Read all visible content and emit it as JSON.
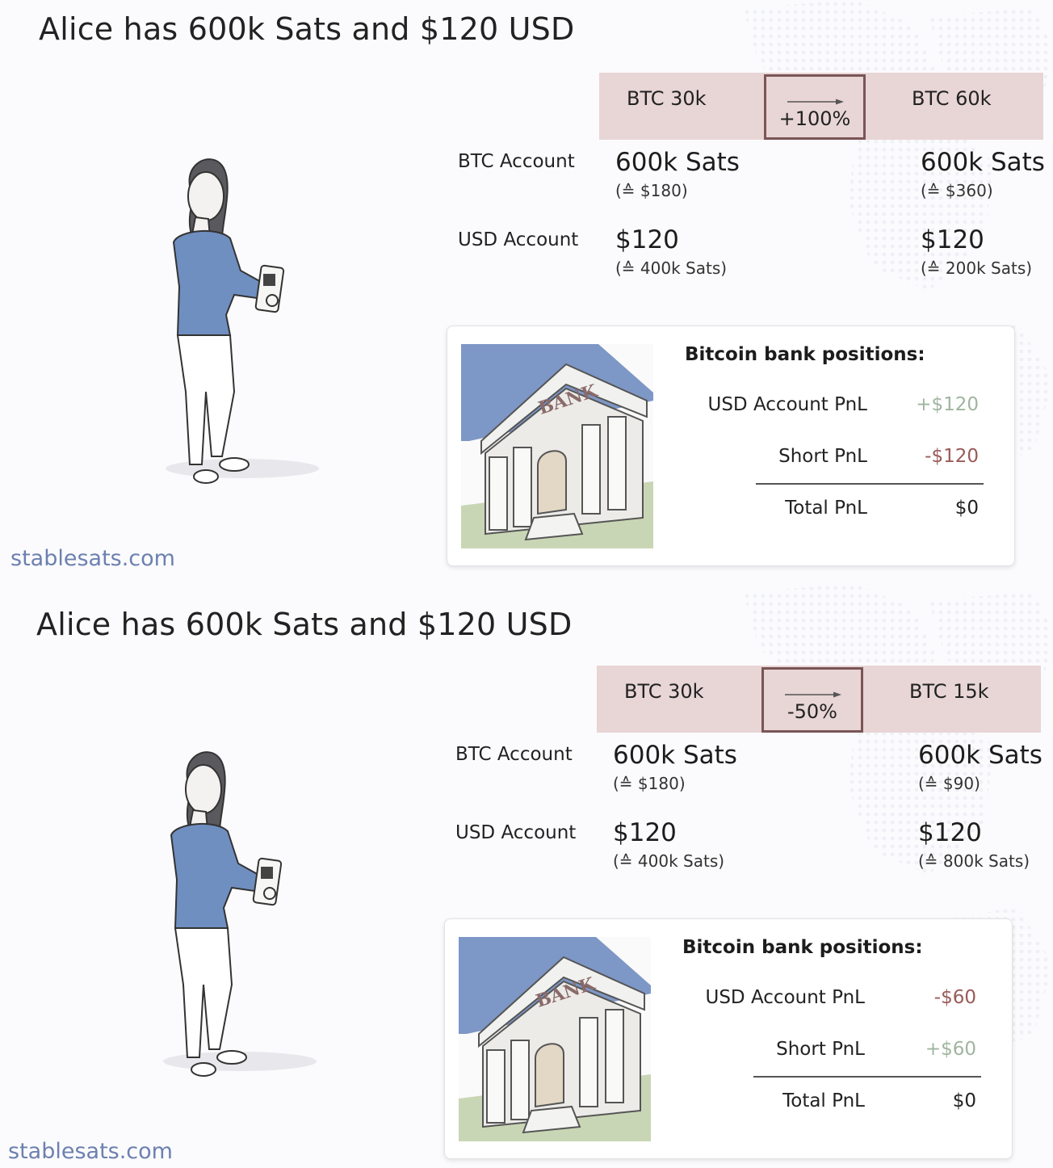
{
  "panels": [
    {
      "title": "Alice has 600k Sats and $120 USD",
      "price_from": "BTC 30k",
      "price_change": "+100%",
      "price_to": "BTC 60k",
      "btc_account": {
        "label": "BTC Account",
        "before": "600k Sats",
        "before_equiv": "(≙ $180)",
        "after": "600k Sats",
        "after_equiv": "(≙ $360)"
      },
      "usd_account": {
        "label": "USD Account",
        "before": "$120",
        "before_equiv": "(≙ 400k Sats)",
        "after": "$120",
        "after_equiv": "(≙ 200k Sats)"
      },
      "bank": {
        "bank_sign": "BANK",
        "title": "Bitcoin bank positions:",
        "usd_pnl_label": "USD Account PnL",
        "usd_pnl_value": "+$120",
        "usd_pnl_color": "#9fb59f",
        "short_pnl_label": "Short PnL",
        "short_pnl_value": "-$120",
        "short_pnl_color": "#9a5a58",
        "total_pnl_label": "Total PnL",
        "total_pnl_value": "$0"
      },
      "brand": "stablesats.com"
    },
    {
      "title": "Alice has 600k Sats and $120 USD",
      "price_from": "BTC 30k",
      "price_change": "-50%",
      "price_to": "BTC 15k",
      "btc_account": {
        "label": "BTC Account",
        "before": "600k Sats",
        "before_equiv": "(≙ $180)",
        "after": "600k Sats",
        "after_equiv": "(≙ $90)"
      },
      "usd_account": {
        "label": "USD Account",
        "before": "$120",
        "before_equiv": "(≙ 400k Sats)",
        "after": "$120",
        "after_equiv": "(≙ 800k Sats)"
      },
      "bank": {
        "bank_sign": "BANK",
        "title": "Bitcoin bank positions:",
        "usd_pnl_label": "USD Account PnL",
        "usd_pnl_value": "-$60",
        "usd_pnl_color": "#9a5a58",
        "short_pnl_label": "Short PnL",
        "short_pnl_value": "+$60",
        "short_pnl_color": "#9fb59f",
        "total_pnl_label": "Total PnL",
        "total_pnl_value": "$0"
      },
      "brand": "stablesats.com"
    }
  ],
  "colors": {
    "price_bar_bg": "#e8d5d5",
    "change_box_border": "#7a5456",
    "brand_text": "#6c80b0",
    "positive_pnl": "#9fb59f",
    "negative_pnl": "#9a5a58",
    "shirt": "#6f8fc0",
    "bank_roof": "#7d97c6"
  }
}
